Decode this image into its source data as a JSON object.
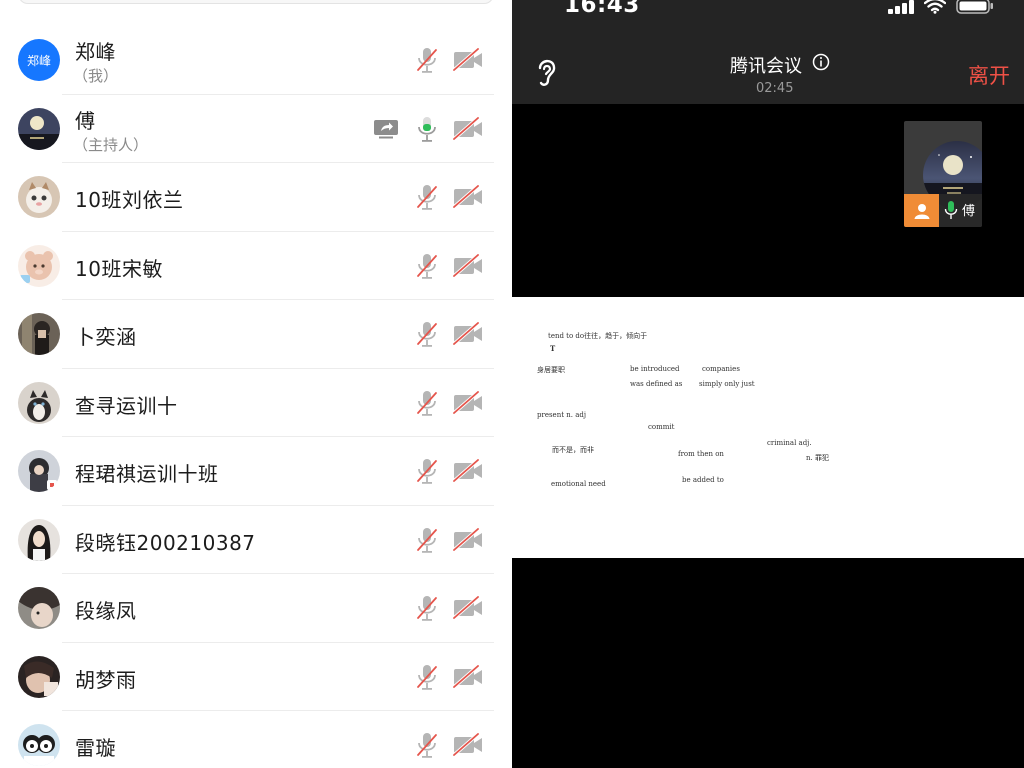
{
  "participants": [
    {
      "name": "郑峰",
      "role": "（我）",
      "avatar_text": "郑峰",
      "avatar_color": "#1677ff",
      "sharing": false,
      "mic_on": false
    },
    {
      "name": "傅",
      "role": "（主持人）",
      "sharing": true,
      "mic_on": true
    },
    {
      "name": "10班刘依兰",
      "role": "",
      "sharing": false,
      "mic_on": false
    },
    {
      "name": "10班宋敏",
      "role": "",
      "sharing": false,
      "mic_on": false
    },
    {
      "name": "卜奕涵",
      "role": "",
      "sharing": false,
      "mic_on": false
    },
    {
      "name": "查寻运训十",
      "role": "",
      "sharing": false,
      "mic_on": false
    },
    {
      "name": "程珺祺运训十班",
      "role": "",
      "sharing": false,
      "mic_on": false
    },
    {
      "name": "段晓钰200210387",
      "role": "",
      "sharing": false,
      "mic_on": false
    },
    {
      "name": "段缘凤",
      "role": "",
      "sharing": false,
      "mic_on": false
    },
    {
      "name": "胡梦雨",
      "role": "",
      "sharing": false,
      "mic_on": false
    },
    {
      "name": "雷璇",
      "role": "",
      "sharing": false,
      "mic_on": false
    }
  ],
  "status_bar": {
    "time": "16:43"
  },
  "meeting": {
    "title": "腾讯会议",
    "timer": "02:45",
    "leave_label": "离开",
    "thumbnail_name": "傅"
  },
  "slide_words": [
    "tend to do往往，趋于，倾向于",
    "T",
    "身居要职",
    "be introduced",
    "companies",
    "was defined as",
    "simply  only just",
    "present  n. adj",
    "commit",
    "criminal  adj.",
    "而不是，而非",
    "from then on",
    "n. 罪犯",
    "emotional need",
    "be added to"
  ],
  "colors": {
    "accent_blue": "#1677ff",
    "leave_red": "#ef5146",
    "muted_icon_gray": "#9c9c9c",
    "muted_slash_red": "#e5554c",
    "mic_active_green": "#2fbd5a",
    "avatar_person_orange": "#f08c36"
  },
  "icons": {
    "mic": "microphone-muted-icon",
    "cam": "camera-off-icon",
    "share": "screen-share-icon",
    "ear": "ear-icon",
    "info": "info-icon"
  }
}
